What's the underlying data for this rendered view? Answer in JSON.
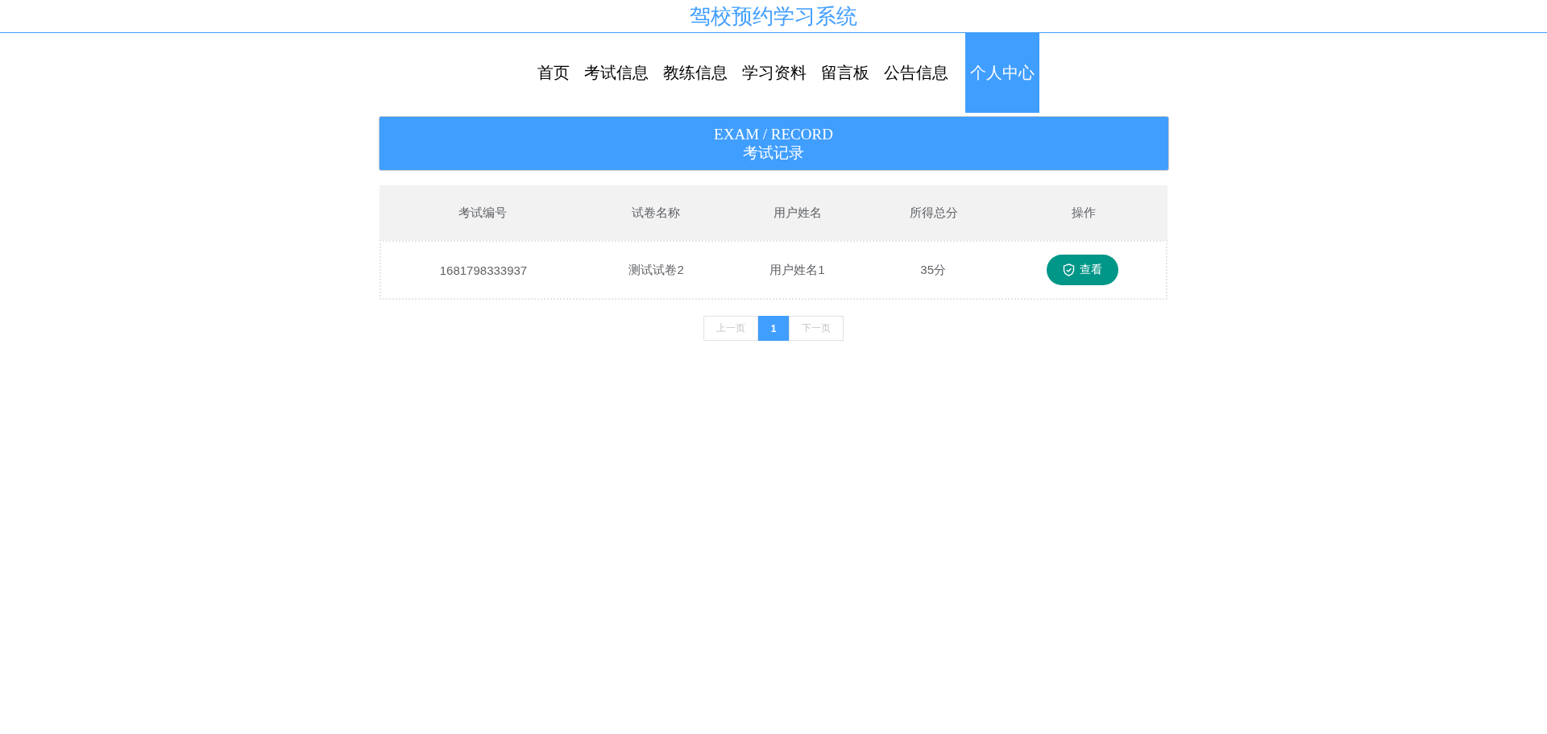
{
  "header": {
    "title": "驾校预约学习系统"
  },
  "nav": [
    {
      "label": "首页",
      "selected": false
    },
    {
      "label": "考试信息",
      "selected": false
    },
    {
      "label": "教练信息",
      "selected": false
    },
    {
      "label": "学习资料",
      "selected": false
    },
    {
      "label": "留言板",
      "selected": false
    },
    {
      "label": "公告信息",
      "selected": false
    },
    {
      "label": "个人中心",
      "selected": true
    }
  ],
  "banner": {
    "title_en": "EXAM / RECORD",
    "title": "考试记录"
  },
  "table": {
    "columns": [
      "考试编号",
      "试卷名称",
      "用户姓名",
      "所得总分",
      "操作"
    ],
    "rows": [
      {
        "cells": [
          "1681798333937",
          "测试试卷2",
          "用户姓名1",
          "35分"
        ],
        "action": "查看"
      }
    ]
  },
  "pagination": {
    "prev": "上一页",
    "pages": [
      {
        "label": "1",
        "selected": true
      }
    ],
    "next": "下一页"
  }
}
